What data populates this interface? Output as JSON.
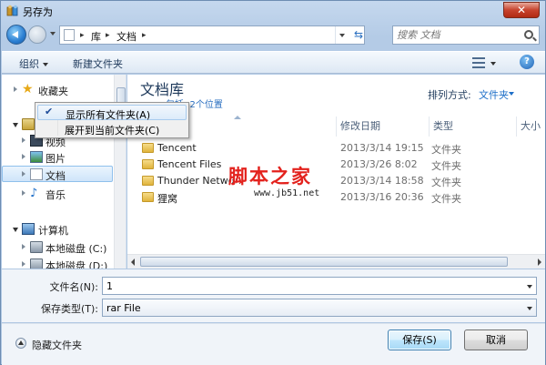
{
  "window": {
    "title": "另存为",
    "close_label": "✕"
  },
  "address": {
    "breadcrumbs": [
      "库",
      "文档"
    ],
    "search_placeholder": "搜索 文档"
  },
  "toolbar": {
    "organize_label": "组织",
    "new_folder_label": "新建文件夹",
    "help_label": "?"
  },
  "nav": {
    "items": [
      {
        "label": "收藏夹",
        "icon": "star-icon"
      },
      {
        "label": "库",
        "icon": "library-icon"
      },
      {
        "label": "视频",
        "icon": "video-icon"
      },
      {
        "label": "图片",
        "icon": "picture-icon"
      },
      {
        "label": "文档",
        "icon": "document-icon"
      },
      {
        "label": "音乐",
        "icon": "music-icon"
      },
      {
        "label": "计算机",
        "icon": "computer-icon"
      },
      {
        "label": "本地磁盘 (C:)",
        "icon": "disk-icon"
      },
      {
        "label": "本地磁盘 (D:)",
        "icon": "disk-icon"
      }
    ]
  },
  "context_menu": {
    "items": [
      {
        "label": "显示所有文件夹(A)",
        "checked": true
      },
      {
        "label": "展开到当前文件夹(C)",
        "checked": false
      }
    ],
    "check_glyph": "✔"
  },
  "content": {
    "library_title": "文档库",
    "library_subtitle": "包括: 2个位置",
    "arrange_label": "排列方式:",
    "arrange_value": "文件夹",
    "columns": {
      "date": "修改日期",
      "type": "类型",
      "size": "大小"
    },
    "rows": [
      {
        "name": "Tencent",
        "date": "2013/3/14 19:15",
        "type": "文件夹"
      },
      {
        "name": "Tencent Files",
        "date": "2013/3/26 8:02",
        "type": "文件夹"
      },
      {
        "name": "Thunder Network",
        "date": "2013/3/14 18:58",
        "type": "文件夹"
      },
      {
        "name": "狸窝",
        "date": "2013/3/16 20:36",
        "type": "文件夹"
      }
    ]
  },
  "watermark": {
    "text": "脚本之家",
    "url": "www.jb51.net"
  },
  "form": {
    "filename_label": "文件名(N):",
    "filename_value": "1",
    "filetype_label": "保存类型(T):",
    "filetype_value": "rar File"
  },
  "footer": {
    "hide_folders_label": "隐藏文件夹",
    "save_label": "保存(S)",
    "cancel_label": "取消"
  },
  "colors": {
    "accent": "#1e6fc8",
    "title_text": "#1e395b",
    "watermark_red": "#e3221d"
  }
}
